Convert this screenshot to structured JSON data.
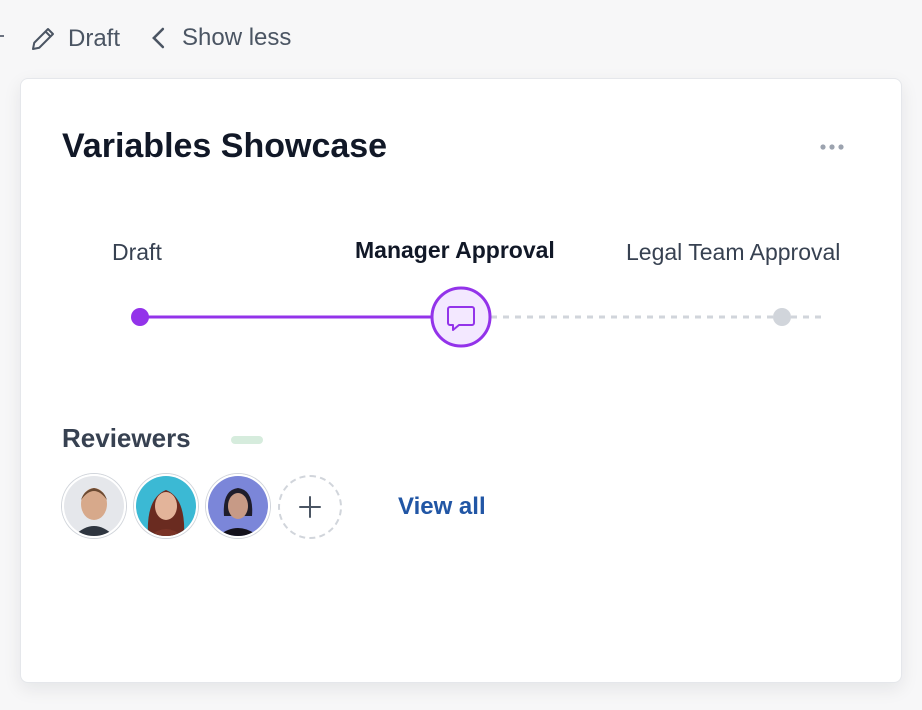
{
  "header": {
    "status_label": "Draft",
    "toggle_label": "Show less"
  },
  "card": {
    "title": "Variables Showcase",
    "workflow": {
      "steps": [
        {
          "label": "Draft",
          "state": "completed"
        },
        {
          "label": "Manager Approval",
          "state": "current"
        },
        {
          "label": "Legal Team Approval",
          "state": "pending"
        }
      ]
    },
    "reviewers": {
      "title": "Reviewers",
      "view_all_label": "View all"
    }
  },
  "colors": {
    "accent_purple": "#9333ea",
    "link_blue": "#2156a5",
    "pending_gray": "#d1d5db",
    "badge_green": "#d6ecdd"
  }
}
